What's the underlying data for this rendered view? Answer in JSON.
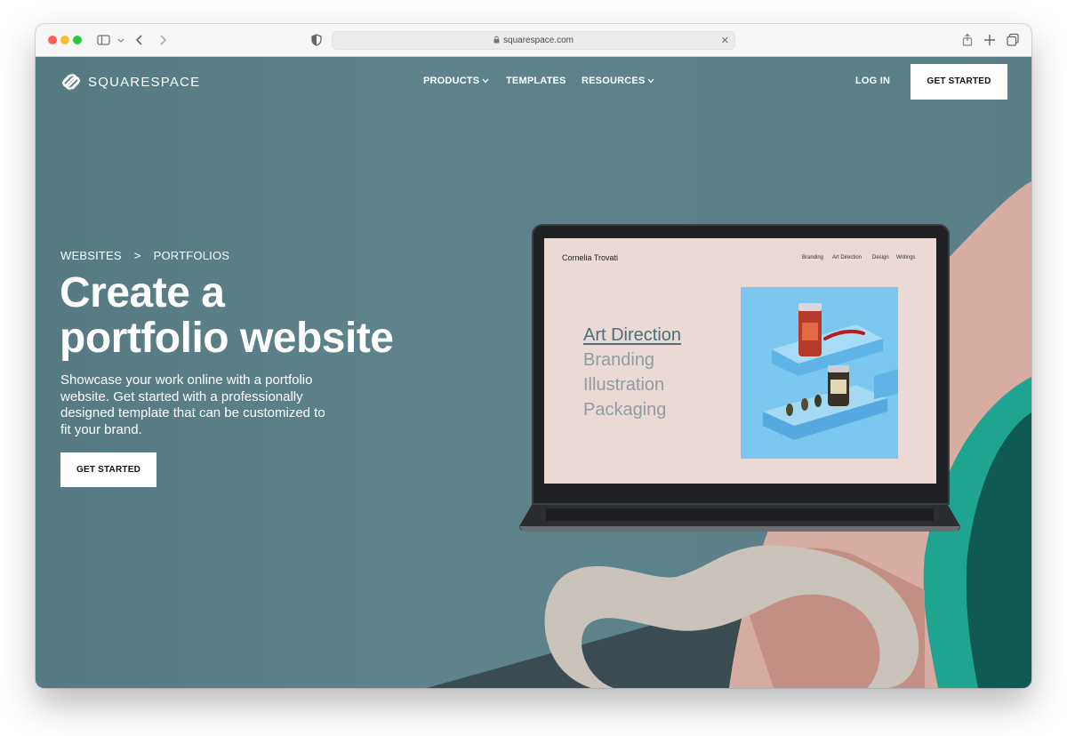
{
  "browser": {
    "url": "squarespace.com"
  },
  "site": {
    "brand": "SQUARESPACE",
    "nav": {
      "products": "PRODUCTS",
      "templates": "TEMPLATES",
      "resources": "RESOURCES",
      "login": "LOG IN",
      "get_started": "GET STARTED"
    },
    "breadcrumb": {
      "first": "WEBSITES",
      "separator": ">",
      "second": "PORTFOLIOS"
    },
    "headline_line1": "Create a",
    "headline_line2": "portfolio website",
    "subtitle": "Showcase your work online with a portfolio website. Get started with a professionally designed template that can be customized to fit your brand.",
    "hero_cta": "GET STARTED",
    "colors": {
      "hero_background": "#5c8189",
      "button_background": "#ffffff",
      "text": "#ffffff"
    }
  },
  "mockup": {
    "site_name": "Cornelia Trovati",
    "nav": [
      "Branding",
      "Art Direction",
      "Design",
      "Writings"
    ],
    "menu": [
      "Art Direction",
      "Branding",
      "Illustration",
      "Packaging"
    ],
    "active_menu": "Art Direction"
  }
}
